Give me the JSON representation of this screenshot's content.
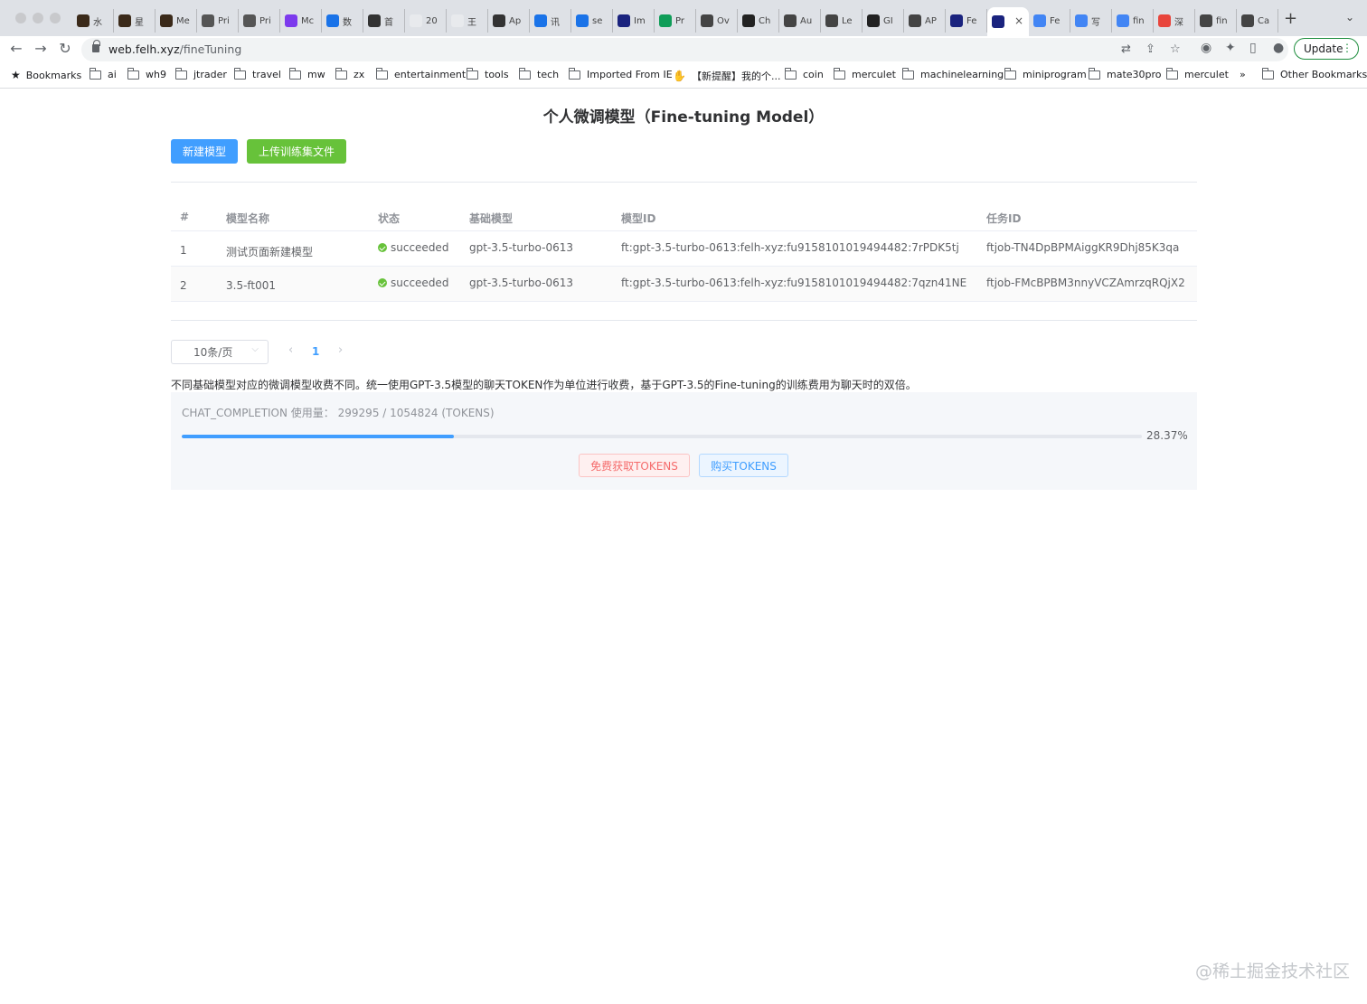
{
  "browser": {
    "tabs": [
      {
        "label": "水",
        "icon": "#3b2a1a"
      },
      {
        "label": "星",
        "icon": "#3b2a1a"
      },
      {
        "label": "Me",
        "icon": "#3b2a1a"
      },
      {
        "label": "Pri",
        "icon": "#555555"
      },
      {
        "label": "Pri",
        "icon": "#555555"
      },
      {
        "label": "Mc",
        "icon": "#7c3aed"
      },
      {
        "label": "数",
        "icon": "#1a73e8"
      },
      {
        "label": "首",
        "icon": "#333333"
      },
      {
        "label": "20",
        "icon": "#e8eaed"
      },
      {
        "label": "王",
        "icon": "#e8eaed"
      },
      {
        "label": "Ap",
        "icon": "#333333"
      },
      {
        "label": "讯",
        "icon": "#1a73e8"
      },
      {
        "label": "se",
        "icon": "#1a73e8"
      },
      {
        "label": "Im",
        "icon": "#1a237e"
      },
      {
        "label": "Pr",
        "icon": "#0f9d58"
      },
      {
        "label": "Ov",
        "icon": "#444444"
      },
      {
        "label": "Ch",
        "icon": "#222222"
      },
      {
        "label": "Au",
        "icon": "#444444"
      },
      {
        "label": "Le",
        "icon": "#444444"
      },
      {
        "label": "GI",
        "icon": "#222222"
      },
      {
        "label": "AP",
        "icon": "#444444"
      },
      {
        "label": "Fe",
        "icon": "#1a237e"
      },
      {
        "label": "",
        "icon": "#1a237e",
        "active": true
      },
      {
        "label": "Fe",
        "icon": "#4285f4"
      },
      {
        "label": "写",
        "icon": "#4285f4"
      },
      {
        "label": "fin",
        "icon": "#4285f4"
      },
      {
        "label": "深",
        "icon": "#e8453c"
      },
      {
        "label": "fin",
        "icon": "#444444"
      },
      {
        "label": "Ca",
        "icon": "#444444"
      }
    ],
    "url_host": "web.felh.xyz",
    "url_path": "/fineTuning",
    "update_label": "Update",
    "bookmarks": [
      {
        "label": "Bookmarks",
        "type": "star"
      },
      {
        "label": "ai",
        "type": "folder"
      },
      {
        "label": "wh9",
        "type": "folder"
      },
      {
        "label": "jtrader",
        "type": "folder"
      },
      {
        "label": "travel",
        "type": "folder"
      },
      {
        "label": "mw",
        "type": "folder"
      },
      {
        "label": "zx",
        "type": "folder"
      },
      {
        "label": "entertainment",
        "type": "folder"
      },
      {
        "label": "tools",
        "type": "folder"
      },
      {
        "label": "tech",
        "type": "folder"
      },
      {
        "label": "Imported From IE",
        "type": "folder"
      },
      {
        "label": "【新提醒】我的个...",
        "type": "page"
      },
      {
        "label": "coin",
        "type": "folder"
      },
      {
        "label": "merculet",
        "type": "folder"
      },
      {
        "label": "machinelearning",
        "type": "folder"
      },
      {
        "label": "miniprogram",
        "type": "folder"
      },
      {
        "label": "mate30pro",
        "type": "folder"
      },
      {
        "label": "merculet",
        "type": "folder"
      }
    ],
    "bookmarks_overflow": "»",
    "other_bookmarks": "Other Bookmarks"
  },
  "page": {
    "title": "个人微调模型（Fine-tuning Model）",
    "new_model_button": "新建模型",
    "upload_button": "上传训练集文件"
  },
  "table": {
    "headers": [
      "#",
      "模型名称",
      "状态",
      "基础模型",
      "模型ID",
      "任务ID"
    ],
    "rows": [
      {
        "index": "1",
        "name": "测试页面新建模型",
        "status": "succeeded",
        "base_model": "gpt-3.5-turbo-0613",
        "model_id": "ft:gpt-3.5-turbo-0613:felh-xyz:fu9158101019494482:7rPDK5tj",
        "job_id": "ftjob-TN4DpBPMAiggKR9Dhj85K3qa"
      },
      {
        "index": "2",
        "name": "3.5-ft001",
        "status": "succeeded",
        "base_model": "gpt-3.5-turbo-0613",
        "model_id": "ft:gpt-3.5-turbo-0613:felh-xyz:fu9158101019494482:7qzn41NE",
        "job_id": "ftjob-FMcBPBM3nnyVCZAmrzqRQjX2"
      }
    ]
  },
  "pagination": {
    "page_size": "10条/页",
    "current_page": "1",
    "prev": "‹",
    "next": "›"
  },
  "usage": {
    "note": "不同基础模型对应的微调模型收费不同。统一使用GPT-3.5模型的聊天TOKEN作为单位进行收费，基于GPT-3.5的Fine-tuning的训练费用为聊天时的双倍。",
    "label": "CHAT_COMPLETION 使用量：",
    "value": "299295 / 1054824 (TOKENS)",
    "percent_text": "28.37%",
    "percent": 28.37,
    "free_button": "免费获取TOKENS",
    "buy_button": "购买TOKENS"
  },
  "watermark": "@稀土掘金技术社区",
  "colors": {
    "primary": "#409eff",
    "success": "#67c23a",
    "danger": "#f56c6c"
  }
}
